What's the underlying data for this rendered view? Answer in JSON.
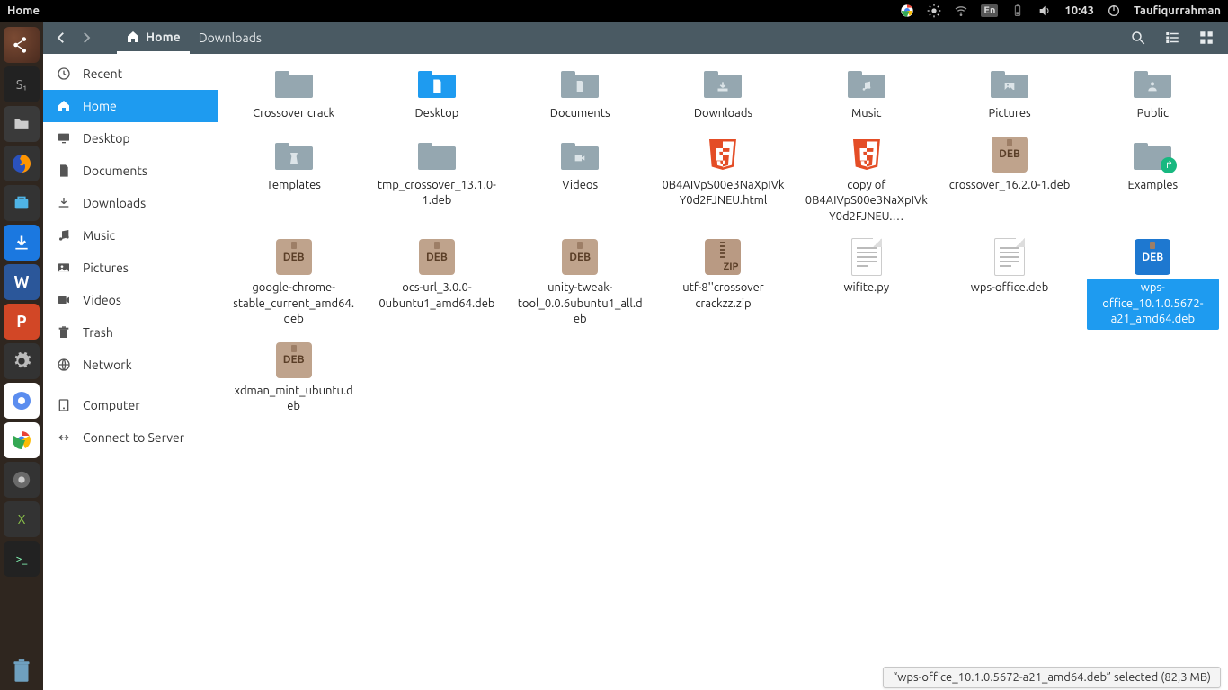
{
  "menubar": {
    "title": "Home",
    "time": "10:43",
    "user": "Taufiqurrahman",
    "input_indicator": "En"
  },
  "toolbar": {
    "path": [
      {
        "label": "Home",
        "active": true,
        "home": true
      },
      {
        "label": "Downloads",
        "active": false
      }
    ]
  },
  "sidebar": {
    "items": [
      {
        "label": "Recent",
        "icon": "clock"
      },
      {
        "label": "Home",
        "icon": "home",
        "active": true
      },
      {
        "label": "Desktop",
        "icon": "desktop"
      },
      {
        "label": "Documents",
        "icon": "documents"
      },
      {
        "label": "Downloads",
        "icon": "downloads"
      },
      {
        "label": "Music",
        "icon": "music"
      },
      {
        "label": "Pictures",
        "icon": "pictures"
      },
      {
        "label": "Videos",
        "icon": "videos"
      },
      {
        "label": "Trash",
        "icon": "trash"
      },
      {
        "label": "Network",
        "icon": "network"
      }
    ],
    "footer": [
      {
        "label": "Computer",
        "icon": "computer"
      },
      {
        "label": "Connect to Server",
        "icon": "connect"
      }
    ]
  },
  "files": [
    {
      "type": "folder",
      "label": "Crossover crack"
    },
    {
      "type": "folder-desktop",
      "label": "Desktop"
    },
    {
      "type": "folder",
      "glyph": "doc",
      "label": "Documents"
    },
    {
      "type": "folder",
      "glyph": "dl",
      "label": "Downloads"
    },
    {
      "type": "folder",
      "glyph": "music",
      "label": "Music"
    },
    {
      "type": "folder",
      "glyph": "pic",
      "label": "Pictures"
    },
    {
      "type": "folder",
      "glyph": "pub",
      "label": "Public"
    },
    {
      "type": "folder",
      "glyph": "tmpl",
      "label": "Templates"
    },
    {
      "type": "folder",
      "label": "tmp_crossover_13.1.0-1.deb"
    },
    {
      "type": "folder",
      "glyph": "vid",
      "label": "Videos"
    },
    {
      "type": "html",
      "label": "0B4AIVpS00e3NaXpIVkY0d2FJNEU.html"
    },
    {
      "type": "html",
      "label": "copy of 0B4AIVpS00e3NaXpIVkY0d2FJNEU.…"
    },
    {
      "type": "deb",
      "label": "crossover_16.2.0-1.deb"
    },
    {
      "type": "folder-examples",
      "label": "Examples"
    },
    {
      "type": "deb",
      "label": "google-chrome-stable_current_amd64.deb"
    },
    {
      "type": "deb",
      "label": "ocs-url_3.0.0-0ubuntu1_amd64.deb"
    },
    {
      "type": "deb",
      "label": "unity-tweak-tool_0.0.6ubuntu1_all.deb"
    },
    {
      "type": "zip",
      "label": "utf-8''crossover crackzz.zip"
    },
    {
      "type": "text",
      "label": "wifite.py"
    },
    {
      "type": "text",
      "label": "wps-office.deb"
    },
    {
      "type": "deb",
      "label": "wps-office_10.1.0.5672-a21_amd64.deb",
      "selected": true
    },
    {
      "type": "deb",
      "label": "xdman_mint_ubuntu.deb"
    }
  ],
  "status": {
    "text": "“wps-office_10.1.0.5672-a21_amd64.deb” selected  (82,3 MB)"
  }
}
